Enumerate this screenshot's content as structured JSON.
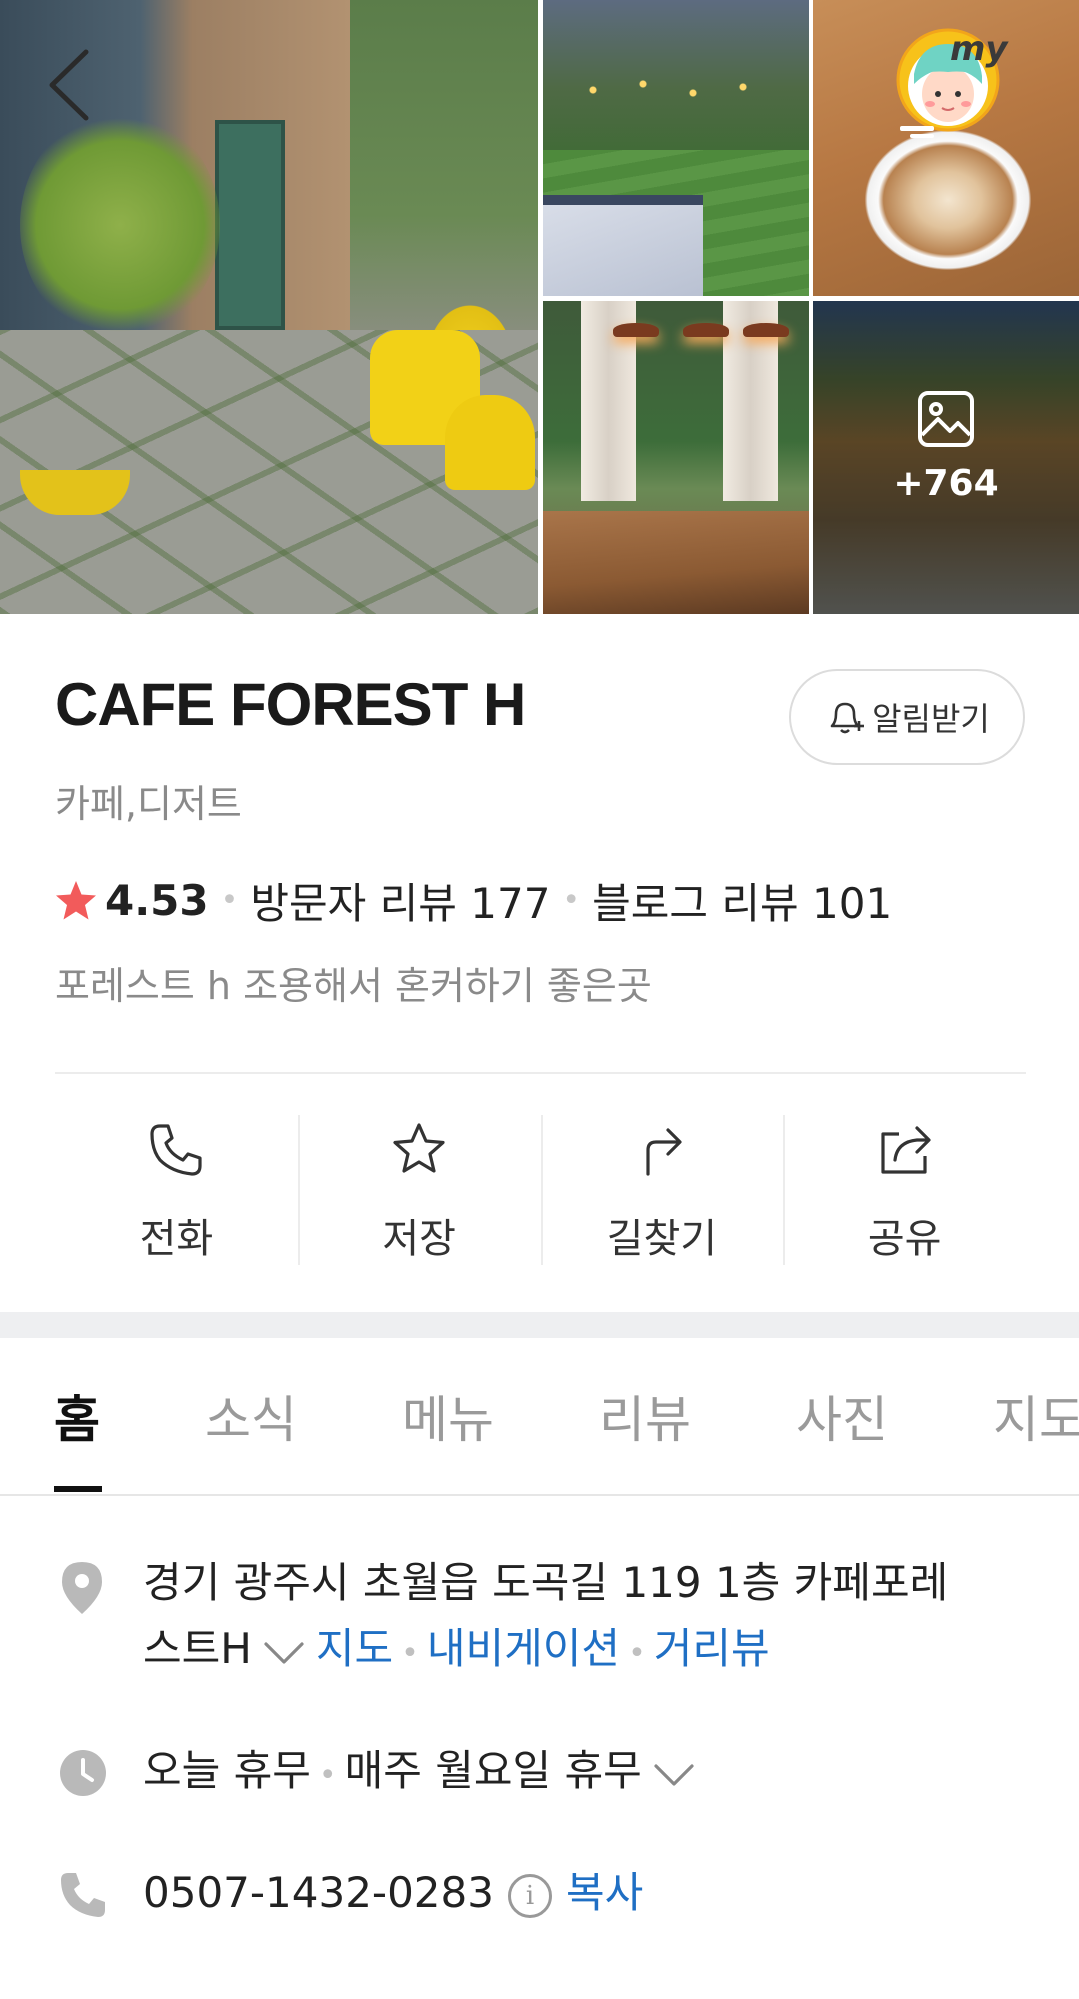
{
  "gallery": {
    "more_photos": "+764",
    "badge_text": "my"
  },
  "place": {
    "name": "CAFE FOREST H",
    "category": "카페,디저트",
    "alert_label": "알림받기",
    "rating": "4.53",
    "visitor_reviews": "방문자 리뷰 177",
    "blog_reviews": "블로그 리뷰 101",
    "tagline": "포레스트 h 조용해서 혼커하기 좋은곳"
  },
  "actions": [
    {
      "label": "전화",
      "icon": "phone-icon"
    },
    {
      "label": "저장",
      "icon": "star-icon"
    },
    {
      "label": "길찾기",
      "icon": "directions-icon"
    },
    {
      "label": "공유",
      "icon": "share-icon"
    }
  ],
  "tabs": [
    "홈",
    "소식",
    "메뉴",
    "리뷰",
    "사진",
    "지도"
  ],
  "details": {
    "address_line1": "경기 광주시 초월읍 도곡길 119 1층 카페포레",
    "address_line2": "스트H",
    "map_link": "지도",
    "navigation_link": "내비게이션",
    "streetview_link": "거리뷰",
    "hours_status": "오늘 휴무",
    "hours_detail": "매주 월요일 휴무",
    "phone": "0507-1432-0283",
    "copy_label": "복사",
    "info_symbol": "i"
  },
  "colors": {
    "accent_link": "#1f6fc4",
    "star": "#f25b5b",
    "badge": "#f7c21a"
  }
}
